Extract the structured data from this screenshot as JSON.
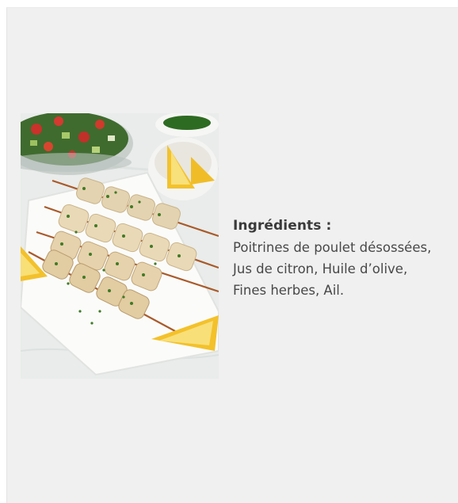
{
  "recipe": {
    "image_alt_icon": "food-photo-icon",
    "ingredients_heading": "Ingrédients :",
    "ingredients_lines": [
      "Poitrines de poulet désossées,",
      "Jus de citron, Huile d’olive,",
      "Fines herbes, Ail."
    ]
  },
  "colors": {
    "background": "#f0f0f0",
    "heading_text": "#3a3a3a",
    "body_text": "#484848"
  }
}
